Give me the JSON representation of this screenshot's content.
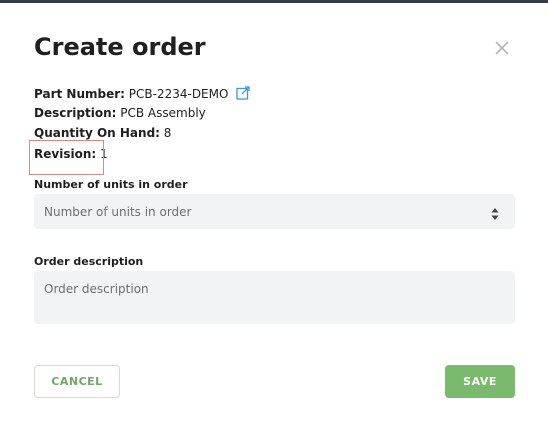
{
  "modal": {
    "title": "Create order",
    "close_icon": "close-icon"
  },
  "part_info": {
    "part_number_label": "Part Number:",
    "part_number_value": "PCB-2234-DEMO",
    "link_icon": "external-link-icon",
    "description_label": "Description:",
    "description_value": "PCB Assembly",
    "quantity_label": "Quantity On Hand:",
    "quantity_value": "8",
    "revision_label": "Revision:",
    "revision_value": "1"
  },
  "form": {
    "units_label": "Number of units in order",
    "units_placeholder": "Number of units in order",
    "units_value": "",
    "description_label": "Order description",
    "description_placeholder": "Order description",
    "description_value": ""
  },
  "actions": {
    "cancel_label": "CANCEL",
    "save_label": "SAVE"
  },
  "colors": {
    "accent_green": "#7aba6c",
    "link_blue": "#3a9be0",
    "highlight_box": "#e0897a",
    "input_bg": "#f2f3f5"
  }
}
